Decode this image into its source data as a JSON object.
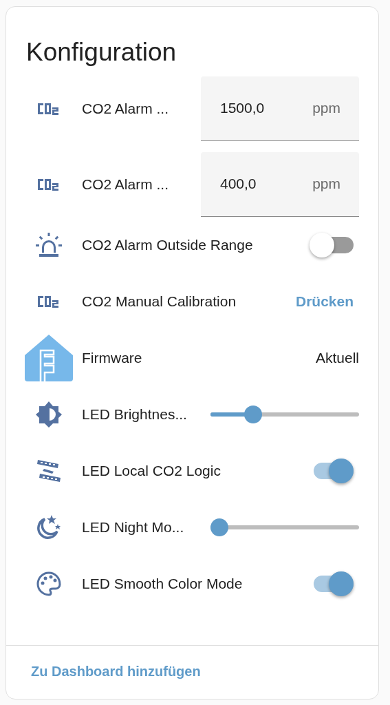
{
  "card": {
    "title": "Konfiguration",
    "entities": [
      {
        "kind": "number",
        "label": "CO2 Alarm ...",
        "value": "1500,0",
        "unit": "ppm"
      },
      {
        "kind": "number",
        "label": "CO2 Alarm ...",
        "value": "400,0",
        "unit": "ppm"
      },
      {
        "kind": "switch",
        "label": "CO2 Alarm Outside Range",
        "on": false
      },
      {
        "kind": "button",
        "label": "CO2 Manual Calibration",
        "action": "Drücken"
      },
      {
        "kind": "text",
        "label": "Firmware",
        "state": "Aktuell"
      },
      {
        "kind": "slider",
        "label": "LED Brightnes...",
        "level": 0.26
      },
      {
        "kind": "switch",
        "label": "LED Local CO2 Logic",
        "on": true
      },
      {
        "kind": "slider",
        "label": "LED Night Mo...",
        "level": 0
      },
      {
        "kind": "switch",
        "label": "LED Smooth Color Mode",
        "on": true
      }
    ],
    "footer": {
      "link": "Zu Dashboard hinzufügen"
    }
  }
}
